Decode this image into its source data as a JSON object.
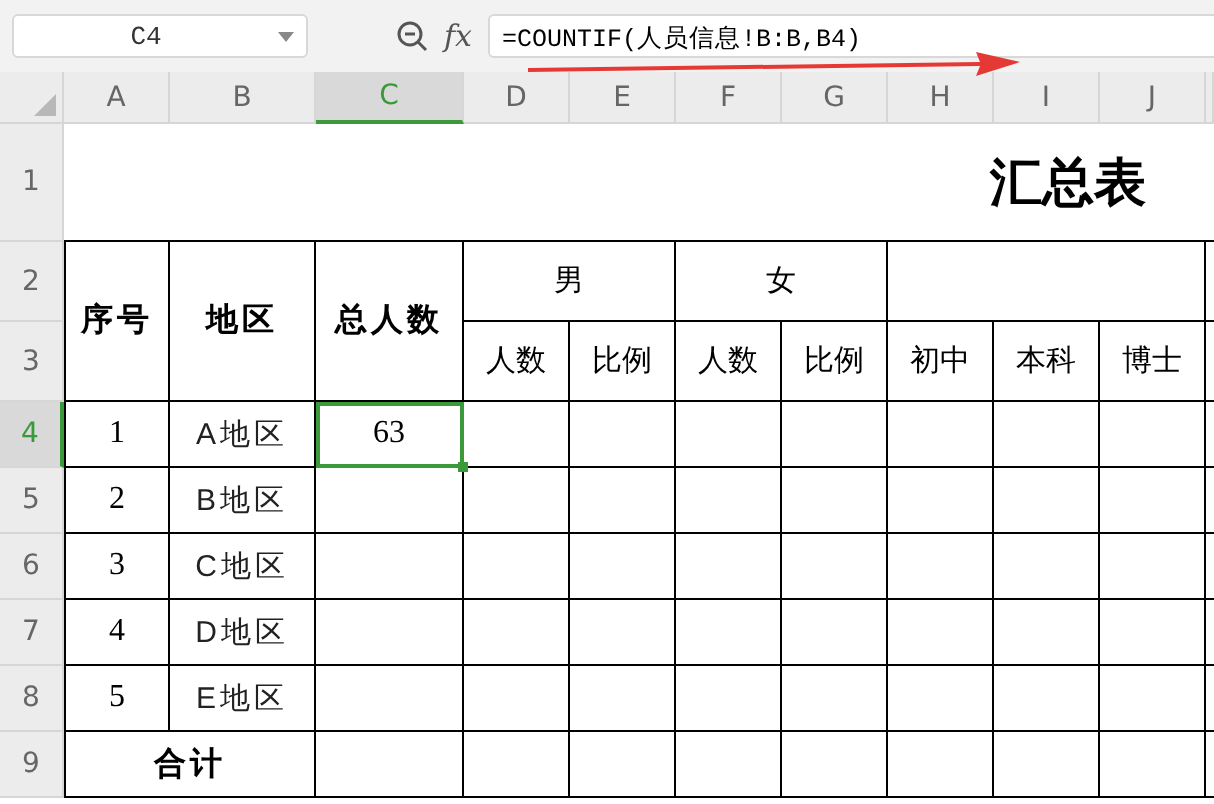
{
  "name_box": {
    "value": "C4"
  },
  "formula_bar": {
    "function_label": "fx",
    "value": "=COUNTIF(人员信息!B:B,B4)"
  },
  "columns": [
    {
      "label": "A",
      "selected": false
    },
    {
      "label": "B",
      "selected": false
    },
    {
      "label": "C",
      "selected": true
    },
    {
      "label": "D",
      "selected": false
    },
    {
      "label": "E",
      "selected": false
    },
    {
      "label": "F",
      "selected": false
    },
    {
      "label": "G",
      "selected": false
    },
    {
      "label": "H",
      "selected": false
    },
    {
      "label": "I",
      "selected": false
    },
    {
      "label": "J",
      "selected": false
    }
  ],
  "rows": [
    {
      "label": "1",
      "selected": false
    },
    {
      "label": "2",
      "selected": false
    },
    {
      "label": "3",
      "selected": false
    },
    {
      "label": "4",
      "selected": true
    },
    {
      "label": "5",
      "selected": false
    },
    {
      "label": "6",
      "selected": false
    },
    {
      "label": "7",
      "selected": false
    },
    {
      "label": "8",
      "selected": false
    },
    {
      "label": "9",
      "selected": false
    }
  ],
  "sheet": {
    "title": "汇总表",
    "headers": {
      "seq": "序号",
      "region": "地区",
      "total": "总人数",
      "male": "男",
      "female": "女",
      "male_sub": [
        "人数",
        "比例"
      ],
      "female_sub": [
        "人数",
        "比例"
      ],
      "education": [
        "初中",
        "本科",
        "博士"
      ]
    },
    "data_rows": [
      {
        "seq": "1",
        "region": "A地区",
        "total": "63",
        "selected": true
      },
      {
        "seq": "2",
        "region": "B地区",
        "selected": false
      },
      {
        "seq": "3",
        "region": "C地区",
        "selected": false
      },
      {
        "seq": "4",
        "region": "D地区",
        "selected": false
      },
      {
        "seq": "5",
        "region": "E地区",
        "selected": false
      }
    ],
    "total_row": {
      "label": "合计"
    }
  }
}
